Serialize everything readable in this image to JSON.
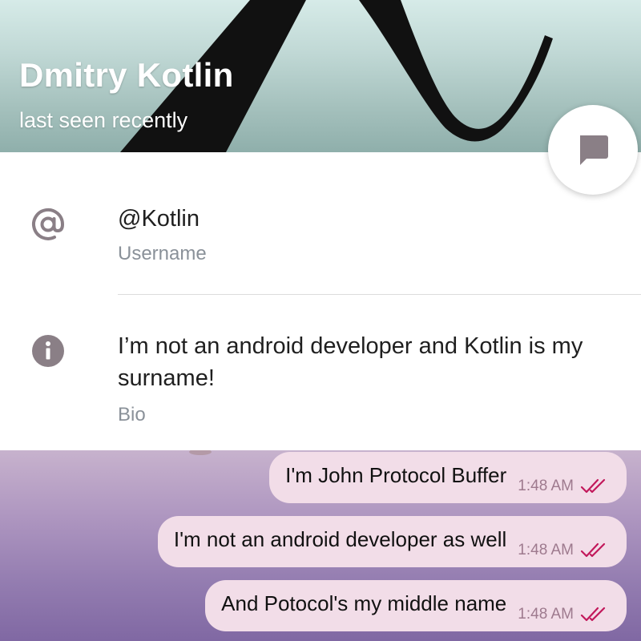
{
  "header": {
    "name": "Dmitry Kotlin",
    "status": "last seen recently"
  },
  "fab": {
    "icon": "chat-bubble-icon"
  },
  "info": {
    "username": {
      "icon": "at-sign-icon",
      "value": "@Kotlin",
      "label": "Username"
    },
    "bio": {
      "icon": "info-icon",
      "line1": "I’m not an android developer and Kotlin is my",
      "line2": "surname!",
      "label": "Bio"
    }
  },
  "messages": [
    {
      "text": "I'm John Protocol Buffer",
      "time": "1:48 AM",
      "status_icon": "double-check-icon"
    },
    {
      "text": "I'm not an android developer as well",
      "time": "1:48 AM",
      "status_icon": "double-check-icon"
    },
    {
      "text": "And Potocol's my middle name",
      "time": "1:48 AM",
      "status_icon": "double-check-icon"
    }
  ],
  "colors": {
    "bubble": "#f2dde8",
    "tick": "#c2185b",
    "icon_gray": "#8a7f86"
  }
}
